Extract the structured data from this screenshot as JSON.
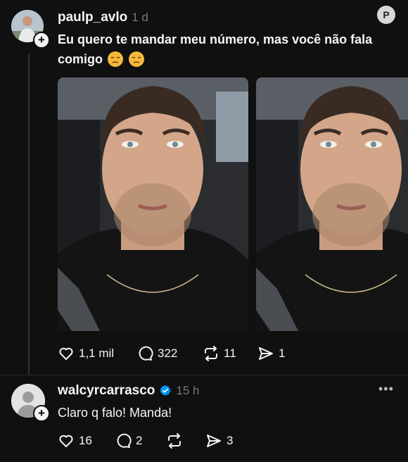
{
  "post": {
    "username": "paulp_avlo",
    "time": "1 d",
    "text_line1": "Eu quero te mandar meu número, mas você não fala",
    "text_line2": "comigo",
    "emoji_name": "pensive-face-emoji",
    "stats": {
      "likes": "1,1 mil",
      "comments": "322",
      "reposts": "11",
      "shares": "1"
    }
  },
  "reply": {
    "username": "walcyrcarrasco",
    "verified": true,
    "time": "15 h",
    "text": "Claro q falo! Manda!",
    "stats": {
      "likes": "16",
      "comments": "2",
      "reposts": "",
      "shares": "3"
    }
  },
  "colors": {
    "background": "#101010",
    "text": "#f3f5f7",
    "muted": "#777777",
    "verified": "#0095f6"
  }
}
